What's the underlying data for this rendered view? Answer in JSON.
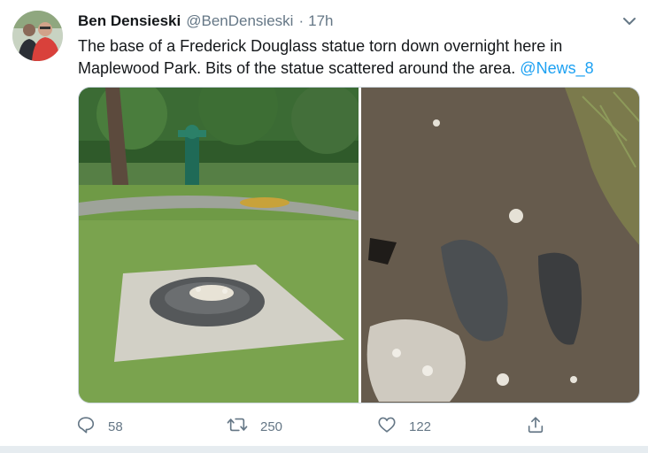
{
  "tweet": {
    "author_name": "Ben Densieski",
    "author_handle": "@BenDensieski",
    "separator": "·",
    "time": "17h",
    "text_main": "The base of a Frederick Douglass statue torn down overnight here in Maplewood Park. Bits of the statue scattered around the area. ",
    "mention": "@News_8"
  },
  "actions": {
    "reply_count": "58",
    "retweet_count": "250",
    "like_count": "122"
  },
  "icons": {
    "reply": "reply-icon",
    "retweet": "retweet-icon",
    "like": "heart-icon",
    "share": "share-icon",
    "more": "chevron-down-icon"
  },
  "colors": {
    "link": "#1da1f2",
    "secondary_text": "#657786",
    "name_text": "#14171a"
  }
}
